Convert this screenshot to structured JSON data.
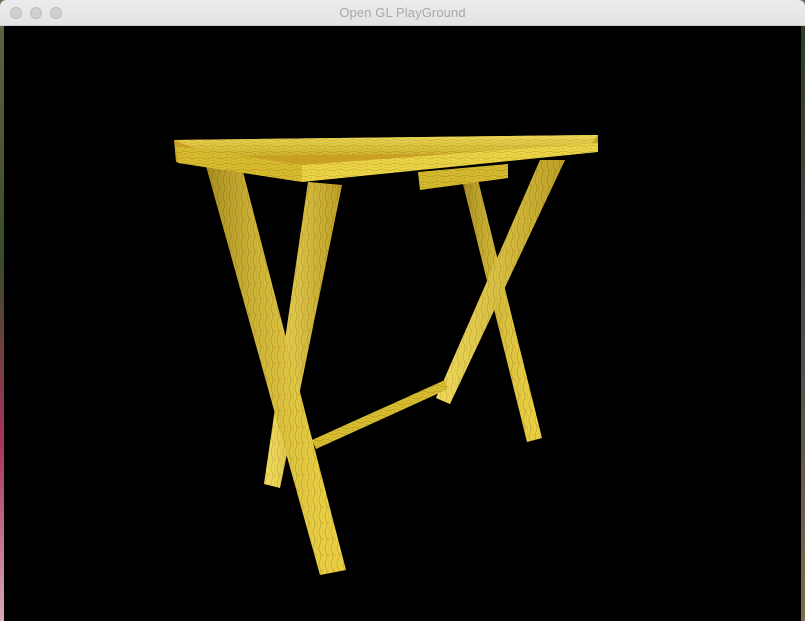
{
  "window": {
    "title": "Open GL PlayGround",
    "controls": {
      "close": "close-button",
      "minimize": "minimize-button",
      "zoom": "zoom-button"
    }
  },
  "scene": {
    "background_color": "#000000",
    "object": "wooden folding table",
    "wood_light_color": "#f2e05a",
    "wood_dark_color": "#b8901c"
  }
}
